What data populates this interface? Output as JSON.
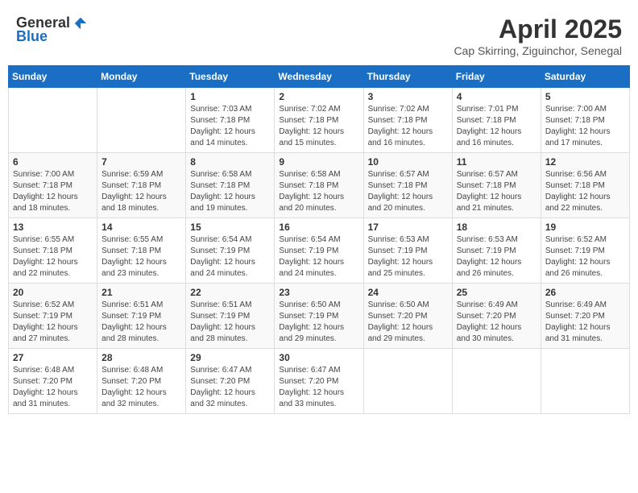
{
  "logo": {
    "general": "General",
    "blue": "Blue"
  },
  "header": {
    "month_year": "April 2025",
    "location": "Cap Skirring, Ziguinchor, Senegal"
  },
  "weekdays": [
    "Sunday",
    "Monday",
    "Tuesday",
    "Wednesday",
    "Thursday",
    "Friday",
    "Saturday"
  ],
  "weeks": [
    [
      {
        "day": "",
        "info": ""
      },
      {
        "day": "",
        "info": ""
      },
      {
        "day": "1",
        "info": "Sunrise: 7:03 AM\nSunset: 7:18 PM\nDaylight: 12 hours and 14 minutes."
      },
      {
        "day": "2",
        "info": "Sunrise: 7:02 AM\nSunset: 7:18 PM\nDaylight: 12 hours and 15 minutes."
      },
      {
        "day": "3",
        "info": "Sunrise: 7:02 AM\nSunset: 7:18 PM\nDaylight: 12 hours and 16 minutes."
      },
      {
        "day": "4",
        "info": "Sunrise: 7:01 PM\nSunset: 7:18 PM\nDaylight: 12 hours and 16 minutes."
      },
      {
        "day": "5",
        "info": "Sunrise: 7:00 AM\nSunset: 7:18 PM\nDaylight: 12 hours and 17 minutes."
      }
    ],
    [
      {
        "day": "6",
        "info": "Sunrise: 7:00 AM\nSunset: 7:18 PM\nDaylight: 12 hours and 18 minutes."
      },
      {
        "day": "7",
        "info": "Sunrise: 6:59 AM\nSunset: 7:18 PM\nDaylight: 12 hours and 18 minutes."
      },
      {
        "day": "8",
        "info": "Sunrise: 6:58 AM\nSunset: 7:18 PM\nDaylight: 12 hours and 19 minutes."
      },
      {
        "day": "9",
        "info": "Sunrise: 6:58 AM\nSunset: 7:18 PM\nDaylight: 12 hours and 20 minutes."
      },
      {
        "day": "10",
        "info": "Sunrise: 6:57 AM\nSunset: 7:18 PM\nDaylight: 12 hours and 20 minutes."
      },
      {
        "day": "11",
        "info": "Sunrise: 6:57 AM\nSunset: 7:18 PM\nDaylight: 12 hours and 21 minutes."
      },
      {
        "day": "12",
        "info": "Sunrise: 6:56 AM\nSunset: 7:18 PM\nDaylight: 12 hours and 22 minutes."
      }
    ],
    [
      {
        "day": "13",
        "info": "Sunrise: 6:55 AM\nSunset: 7:18 PM\nDaylight: 12 hours and 22 minutes."
      },
      {
        "day": "14",
        "info": "Sunrise: 6:55 AM\nSunset: 7:18 PM\nDaylight: 12 hours and 23 minutes."
      },
      {
        "day": "15",
        "info": "Sunrise: 6:54 AM\nSunset: 7:19 PM\nDaylight: 12 hours and 24 minutes."
      },
      {
        "day": "16",
        "info": "Sunrise: 6:54 AM\nSunset: 7:19 PM\nDaylight: 12 hours and 24 minutes."
      },
      {
        "day": "17",
        "info": "Sunrise: 6:53 AM\nSunset: 7:19 PM\nDaylight: 12 hours and 25 minutes."
      },
      {
        "day": "18",
        "info": "Sunrise: 6:53 AM\nSunset: 7:19 PM\nDaylight: 12 hours and 26 minutes."
      },
      {
        "day": "19",
        "info": "Sunrise: 6:52 AM\nSunset: 7:19 PM\nDaylight: 12 hours and 26 minutes."
      }
    ],
    [
      {
        "day": "20",
        "info": "Sunrise: 6:52 AM\nSunset: 7:19 PM\nDaylight: 12 hours and 27 minutes."
      },
      {
        "day": "21",
        "info": "Sunrise: 6:51 AM\nSunset: 7:19 PM\nDaylight: 12 hours and 28 minutes."
      },
      {
        "day": "22",
        "info": "Sunrise: 6:51 AM\nSunset: 7:19 PM\nDaylight: 12 hours and 28 minutes."
      },
      {
        "day": "23",
        "info": "Sunrise: 6:50 AM\nSunset: 7:19 PM\nDaylight: 12 hours and 29 minutes."
      },
      {
        "day": "24",
        "info": "Sunrise: 6:50 AM\nSunset: 7:20 PM\nDaylight: 12 hours and 29 minutes."
      },
      {
        "day": "25",
        "info": "Sunrise: 6:49 AM\nSunset: 7:20 PM\nDaylight: 12 hours and 30 minutes."
      },
      {
        "day": "26",
        "info": "Sunrise: 6:49 AM\nSunset: 7:20 PM\nDaylight: 12 hours and 31 minutes."
      }
    ],
    [
      {
        "day": "27",
        "info": "Sunrise: 6:48 AM\nSunset: 7:20 PM\nDaylight: 12 hours and 31 minutes."
      },
      {
        "day": "28",
        "info": "Sunrise: 6:48 AM\nSunset: 7:20 PM\nDaylight: 12 hours and 32 minutes."
      },
      {
        "day": "29",
        "info": "Sunrise: 6:47 AM\nSunset: 7:20 PM\nDaylight: 12 hours and 32 minutes."
      },
      {
        "day": "30",
        "info": "Sunrise: 6:47 AM\nSunset: 7:20 PM\nDaylight: 12 hours and 33 minutes."
      },
      {
        "day": "",
        "info": ""
      },
      {
        "day": "",
        "info": ""
      },
      {
        "day": "",
        "info": ""
      }
    ]
  ]
}
